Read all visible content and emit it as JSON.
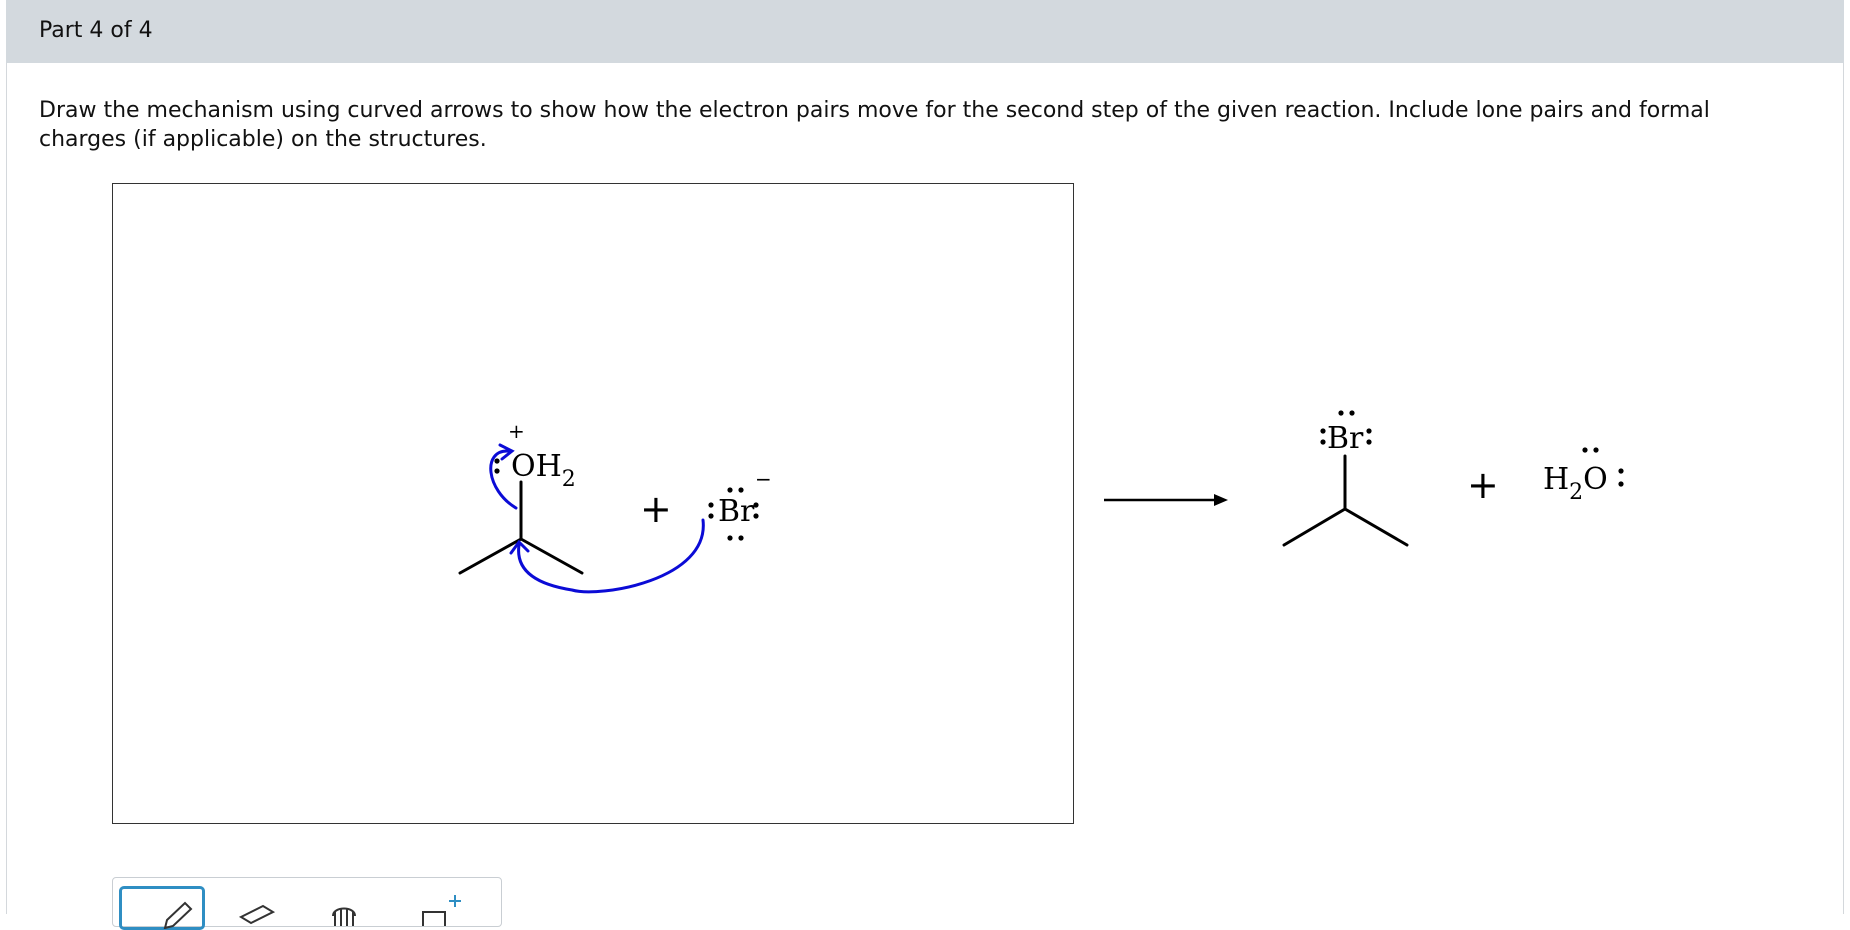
{
  "header": {
    "part_label": "Part 4 of 4"
  },
  "question": {
    "instructions": "Draw the mechanism using curved arrows to show how the electron pairs move for the second step of the given reaction. Include lone pairs and formal charges (if applicable) on the structures."
  },
  "reactants": {
    "oxonium_group": "OH",
    "oxonium_subscript": "2",
    "oxonium_charge": "+",
    "plus_sign": "+",
    "bromide_label": "Br",
    "bromide_charge": "−"
  },
  "products": {
    "bromide_label": "Br",
    "plus_sign": "+",
    "water_h": "H",
    "water_subscript": "2",
    "water_o": "O"
  },
  "colors": {
    "arrow": "#0b0bd6",
    "header_bg": "#d3d9de",
    "tool_selected": "#2f8ec3"
  },
  "toolbar": {
    "tools": [
      "pencil-icon",
      "eraser-icon",
      "hand-icon",
      "add-charge-icon"
    ]
  }
}
